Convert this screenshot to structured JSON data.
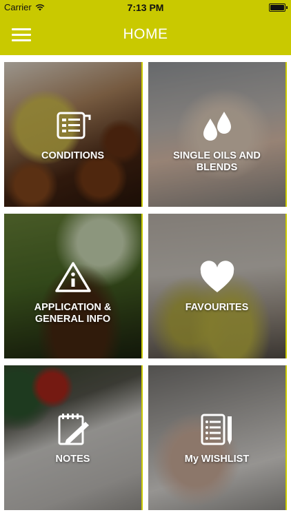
{
  "status_bar": {
    "carrier": "Carrier",
    "time": "7:13 PM"
  },
  "header": {
    "title": "HOME",
    "menu_icon": "hamburger-menu-icon",
    "background_color": "#c9c900"
  },
  "tiles": [
    {
      "label": "CONDITIONS",
      "icon": "scroll-list-icon"
    },
    {
      "label": "SINGLE OILS AND BLENDS",
      "icon": "oil-drops-icon"
    },
    {
      "label": "APPLICATION & GENERAL INFO",
      "icon": "info-warning-icon"
    },
    {
      "label": "FAVOURITES",
      "icon": "heart-icon"
    },
    {
      "label": "NOTES",
      "icon": "notepad-pencil-icon"
    },
    {
      "label": "My WISHLIST",
      "icon": "checklist-pen-icon"
    }
  ]
}
